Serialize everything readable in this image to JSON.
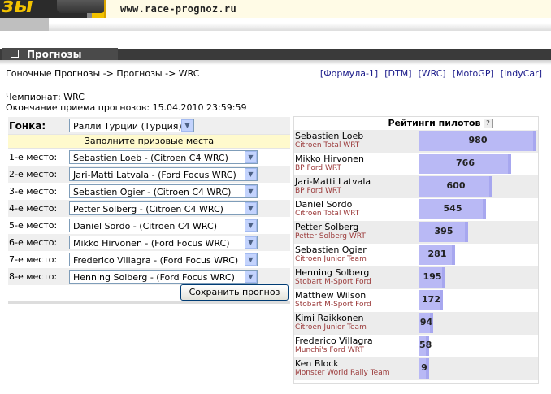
{
  "header": {
    "logo_text": "зы",
    "url": "www.race-prognoz.ru"
  },
  "section": {
    "title": "Прогнозы"
  },
  "breadcrumb": "Гоночные Прогнозы -> Прогнозы -> WRC",
  "categories": [
    "[Формула-1]",
    "[DTM]",
    "[WRC]",
    "[MotoGP]",
    "[IndyCar]"
  ],
  "championship": "Чемпионат: WRC",
  "deadline": "Окончание приема прогнозов: 15.04.2010 23:59:59",
  "form": {
    "race_label": "Гонка:",
    "race_value": "Ралли Турции (Турция)",
    "places_header": "Заполните призовые места",
    "places": [
      {
        "label": "1-е место:",
        "value": "Sebastien Loeb - (Citroen C4 WRC)"
      },
      {
        "label": "2-е место:",
        "value": "Jari-Matti Latvala - (Ford Focus WRC)"
      },
      {
        "label": "3-е место:",
        "value": "Sebastien Ogier - (Citroen C4 WRC)"
      },
      {
        "label": "4-е место:",
        "value": "Petter Solberg - (Citroen C4 WRC)"
      },
      {
        "label": "5-е место:",
        "value": "Daniel Sordo - (Citroen C4 WRC)"
      },
      {
        "label": "6-е место:",
        "value": "Mikko Hirvonen - (Ford Focus WRC)"
      },
      {
        "label": "7-е место:",
        "value": "Frederico Villagra - (Ford Focus WRC)"
      },
      {
        "label": "8-е место:",
        "value": "Henning Solberg - (Ford Focus WRC)"
      }
    ],
    "save_label": "Сохранить прогноз"
  },
  "rating": {
    "title": "Рейтинги пилотов",
    "help": "?",
    "max": 980,
    "drivers": [
      {
        "name": "Sebastien Loeb",
        "team": "Citroen Total WRT",
        "points": 980
      },
      {
        "name": "Mikko Hirvonen",
        "team": "BP Ford WRT",
        "points": 766
      },
      {
        "name": "Jari-Matti Latvala",
        "team": "BP Ford WRT",
        "points": 600
      },
      {
        "name": "Daniel Sordo",
        "team": "Citroen Total WRT",
        "points": 545
      },
      {
        "name": "Petter Solberg",
        "team": "Petter Solberg WRT",
        "points": 395
      },
      {
        "name": "Sebastien Ogier",
        "team": "Citroen Junior Team",
        "points": 281
      },
      {
        "name": "Henning Solberg",
        "team": "Stobart M-Sport Ford",
        "points": 195
      },
      {
        "name": "Matthew Wilson",
        "team": "Stobart M-Sport Ford",
        "points": 172
      },
      {
        "name": "Kimi Raikkonen",
        "team": "Citroen Junior Team",
        "points": 94
      },
      {
        "name": "Frederico Villagra",
        "team": "Munchi's Ford WRT",
        "points": 58
      },
      {
        "name": "Ken Block",
        "team": "Monster World Rally Team",
        "points": 9
      }
    ]
  }
}
